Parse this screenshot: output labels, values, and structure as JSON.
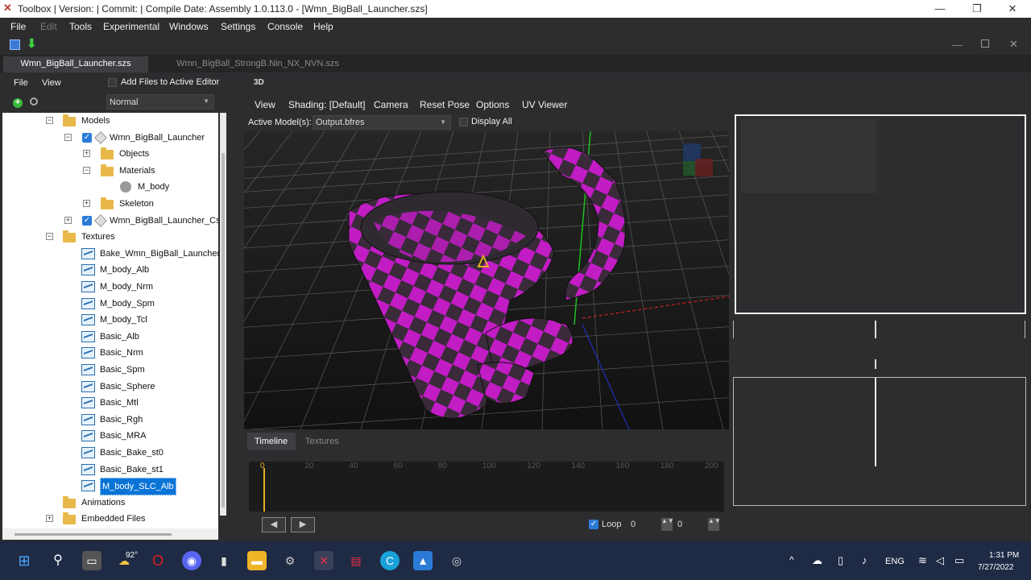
{
  "window": {
    "title": "Toolbox | Version: | Commit: | Compile Date: Assembly 1.0.113.0 - [Wmn_BigBall_Launcher.szs]",
    "minimize": "—",
    "restore": "❐",
    "close": "✕"
  },
  "menu": {
    "items": [
      "File",
      "Edit",
      "Tools",
      "Experimental",
      "Windows",
      "Settings",
      "Console",
      "Help"
    ]
  },
  "doc_tabs": [
    "Wmn_BigBall_Launcher.szs",
    "Wmn_BigBall_StrongB.Nin_NX_NVN.szs"
  ],
  "left_panel": {
    "menu_file": "File",
    "menu_view": "View",
    "add_files_label": "Add Files to Active Editor",
    "filter_value": "Normal",
    "tree": [
      {
        "label": "Models",
        "level": 0,
        "type": "folder",
        "expanded": true
      },
      {
        "label": "Wmn_BigBall_Launcher",
        "level": 1,
        "type": "model",
        "checked": true,
        "expanded": true
      },
      {
        "label": "Objects",
        "level": 2,
        "type": "folder",
        "expanded": false
      },
      {
        "label": "Materials",
        "level": 2,
        "type": "folder",
        "expanded": true
      },
      {
        "label": "M_body",
        "level": 3,
        "type": "material"
      },
      {
        "label": "Skeleton",
        "level": 2,
        "type": "folder",
        "expanded": false
      },
      {
        "label": "Wmn_BigBall_Launcher_Cstm",
        "level": 1,
        "type": "model",
        "checked": true,
        "expanded": false
      },
      {
        "label": "Textures",
        "level": 0,
        "type": "folder",
        "expanded": true
      },
      {
        "label": "Bake_Wmn_BigBall_Launcher_c",
        "level": 1,
        "type": "texture"
      },
      {
        "label": "M_body_Alb",
        "level": 1,
        "type": "texture"
      },
      {
        "label": "M_body_Nrm",
        "level": 1,
        "type": "texture"
      },
      {
        "label": "M_body_Spm",
        "level": 1,
        "type": "texture"
      },
      {
        "label": "M_body_Tcl",
        "level": 1,
        "type": "texture"
      },
      {
        "label": "Basic_Alb",
        "level": 1,
        "type": "texture"
      },
      {
        "label": "Basic_Nrm",
        "level": 1,
        "type": "texture"
      },
      {
        "label": "Basic_Spm",
        "level": 1,
        "type": "texture"
      },
      {
        "label": "Basic_Sphere",
        "level": 1,
        "type": "texture"
      },
      {
        "label": "Basic_Mtl",
        "level": 1,
        "type": "texture"
      },
      {
        "label": "Basic_Rgh",
        "level": 1,
        "type": "texture"
      },
      {
        "label": "Basic_MRA",
        "level": 1,
        "type": "texture"
      },
      {
        "label": "Basic_Bake_st0",
        "level": 1,
        "type": "texture"
      },
      {
        "label": "Basic_Bake_st1",
        "level": 1,
        "type": "texture"
      },
      {
        "label": "M_body_SLC_Alb",
        "level": 1,
        "type": "texture",
        "selected": true
      },
      {
        "label": "Animations",
        "level": 0,
        "type": "folder"
      },
      {
        "label": "Embedded Files",
        "level": 0,
        "type": "folder",
        "expanded": false
      }
    ]
  },
  "viewport": {
    "badge": "3D",
    "menu": [
      "View",
      "Shading: [Default]",
      "Camera",
      "Reset Pose",
      "Options",
      "UV Viewer"
    ],
    "active_models_label": "Active Model(s):",
    "active_models_value": "Output.bfres",
    "display_all_label": "Display All"
  },
  "timeline": {
    "tabs": [
      "Timeline",
      "Textures"
    ],
    "ticks": [
      "0",
      "20",
      "40",
      "60",
      "80",
      "100",
      "120",
      "140",
      "160",
      "180",
      "200"
    ],
    "loop_label": "Loop",
    "loop_value": "0",
    "frame_value": "0"
  },
  "taskbar": {
    "temperature": "92°",
    "language": "ENG",
    "time": "1:31 PM",
    "date": "7/27/2022"
  }
}
